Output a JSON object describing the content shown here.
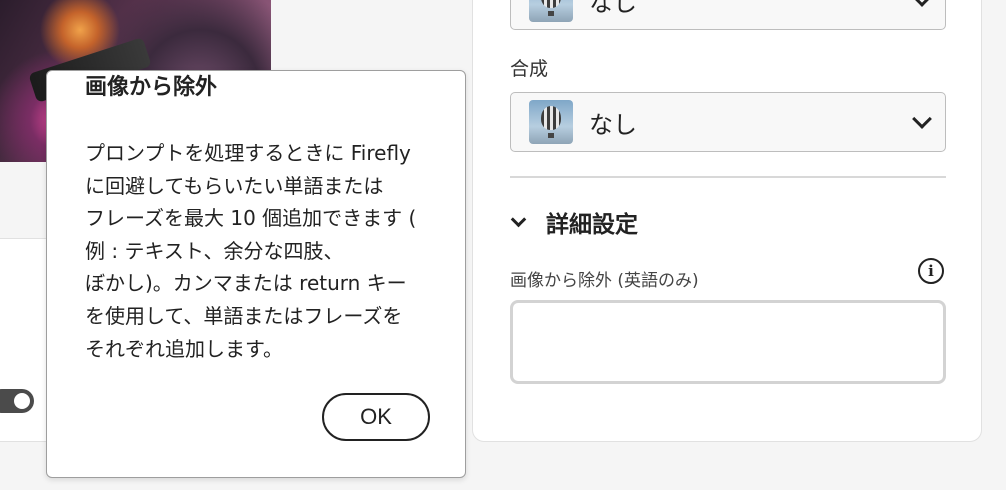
{
  "top_select": {
    "value": "なし",
    "icon": "hot-air-balloon-icon"
  },
  "composite": {
    "label": "合成",
    "value": "なし",
    "icon": "hot-air-balloon-icon"
  },
  "advanced": {
    "title": "詳細設定"
  },
  "exclude": {
    "label": "画像から除外 (英語のみ)",
    "value": ""
  },
  "popover": {
    "title": "画像から除外",
    "lines": [
      "プロンプトを処理するときに Firefly",
      "に回避してもらいたい単語または",
      "フレーズを最大 10 個追加できます (",
      "例 : テキスト、余分な四肢、",
      "ぼかし)。カンマまたは return キー",
      "を使用して、単語またはフレーズを",
      "それぞれ追加します。"
    ],
    "ok_label": "OK"
  }
}
